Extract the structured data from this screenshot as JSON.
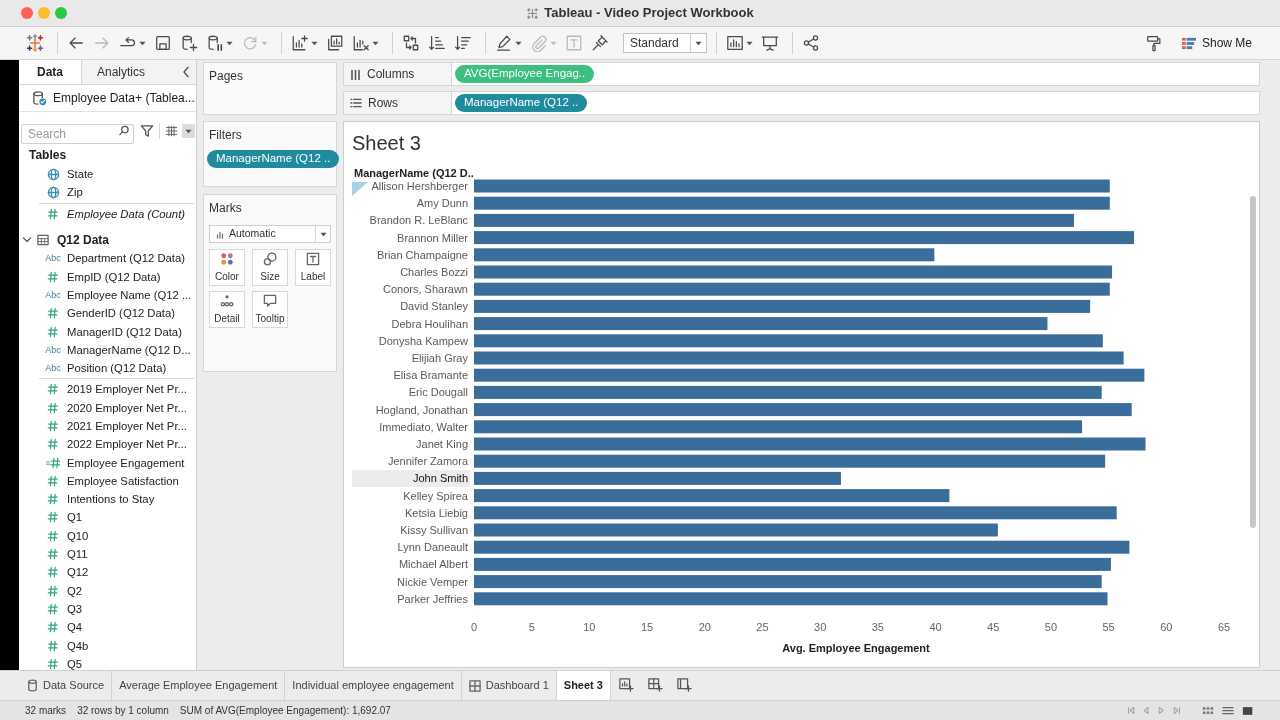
{
  "window": {
    "title": "Tableau - Video Project Workbook"
  },
  "toolbar": {
    "items": [
      {
        "kind": "logo",
        "disabled": false,
        "dropdown": false
      },
      {
        "kind": "separator"
      },
      {
        "kind": "undo",
        "disabled": false,
        "dropdown": false
      },
      {
        "kind": "redo",
        "disabled": true,
        "dropdown": false
      },
      {
        "kind": "replay",
        "disabled": false,
        "dropdown": true
      },
      {
        "kind": "save",
        "disabled": false,
        "dropdown": false
      },
      {
        "kind": "new_data_source",
        "disabled": false,
        "dropdown": false
      },
      {
        "kind": "pause_updates",
        "disabled": false,
        "dropdown": true
      },
      {
        "kind": "refresh",
        "disabled": true,
        "dropdown": true
      },
      {
        "kind": "separator"
      },
      {
        "kind": "new_worksheet",
        "disabled": false,
        "dropdown": true
      },
      {
        "kind": "duplicate",
        "disabled": false,
        "dropdown": false
      },
      {
        "kind": "clear",
        "disabled": false,
        "dropdown": true
      },
      {
        "kind": "separator"
      },
      {
        "kind": "swap",
        "disabled": false,
        "dropdown": false
      },
      {
        "kind": "sort_ascending",
        "disabled": false,
        "dropdown": false
      },
      {
        "kind": "sort_descending",
        "disabled": false,
        "dropdown": false
      },
      {
        "kind": "separator"
      },
      {
        "kind": "highlight",
        "disabled": false,
        "dropdown": true
      },
      {
        "kind": "group",
        "disabled": true,
        "dropdown": true
      },
      {
        "kind": "labels",
        "disabled": true,
        "dropdown": false
      },
      {
        "kind": "pin",
        "disabled": false,
        "dropdown": false
      },
      {
        "kind": "select",
        "value": "Standard"
      },
      {
        "kind": "separator"
      },
      {
        "kind": "show_cards",
        "disabled": false,
        "dropdown": true
      },
      {
        "kind": "presentation",
        "disabled": false,
        "dropdown": false
      },
      {
        "kind": "separator"
      },
      {
        "kind": "share",
        "disabled": false,
        "dropdown": false
      }
    ],
    "right_items": [
      {
        "kind": "format",
        "disabled": false,
        "dropdown": false
      },
      {
        "kind": "show_me",
        "label": "Show Me",
        "disabled": false,
        "dropdown": false
      }
    ]
  },
  "data_pane": {
    "tabs": [
      {
        "label": "Data",
        "selected": true
      },
      {
        "label": "Analytics",
        "selected": false
      }
    ],
    "data_source": "Employee Data+ (Tablea...",
    "search": {
      "placeholder": "Search"
    },
    "tables_heading": "Tables",
    "fields": [
      {
        "label": "State",
        "kind": "geo"
      },
      {
        "label": "Zip",
        "kind": "geo"
      },
      {
        "kind": "separator"
      },
      {
        "label": "Employee Data (Count)",
        "kind": "count"
      },
      {
        "label": "Q12 Data",
        "kind": "table",
        "expanded": true,
        "children": [
          {
            "label": "Department (Q12 Data)",
            "kind": "dimension",
            "type_label": "Abc"
          },
          {
            "label": "EmpID (Q12 Data)",
            "kind": "measure"
          },
          {
            "label": "Employee Name (Q12 ...",
            "kind": "dimension",
            "type_label": "Abc"
          },
          {
            "label": "GenderID (Q12 Data)",
            "kind": "measure"
          },
          {
            "label": "ManagerID (Q12 Data)",
            "kind": "measure"
          },
          {
            "label": "ManagerName (Q12 D...",
            "kind": "dimension",
            "type_label": "Abc"
          },
          {
            "label": "Position (Q12 Data)",
            "kind": "dimension",
            "type_label": "Abc"
          },
          {
            "kind": "separator"
          },
          {
            "label": "2019 Employer Net Pr...",
            "kind": "measure"
          },
          {
            "label": "2020 Employer Net Pr...",
            "kind": "measure"
          },
          {
            "label": "2021 Employer Net Pr...",
            "kind": "measure"
          },
          {
            "label": "2022 Employer Net Pr...",
            "kind": "measure"
          },
          {
            "label": "Employee Engagement",
            "kind": "calc"
          },
          {
            "label": "Employee Satisfaction",
            "kind": "measure"
          },
          {
            "label": "Intentions to Stay",
            "kind": "measure"
          },
          {
            "label": "Q1",
            "kind": "measure"
          },
          {
            "label": "Q10",
            "kind": "measure"
          },
          {
            "label": "Q11",
            "kind": "measure"
          },
          {
            "label": "Q12",
            "kind": "measure"
          },
          {
            "label": "Q2",
            "kind": "measure"
          },
          {
            "label": "Q3",
            "kind": "measure"
          },
          {
            "label": "Q4",
            "kind": "measure"
          },
          {
            "label": "Q4b",
            "kind": "measure"
          },
          {
            "label": "Q5",
            "kind": "measure"
          }
        ]
      }
    ]
  },
  "pages": {
    "title": "Pages"
  },
  "filters": {
    "title": "Filters",
    "pills": [
      {
        "label": "ManagerName (Q12 ..",
        "kind": "dimension"
      }
    ]
  },
  "marks": {
    "title": "Marks",
    "mark_type": "Automatic",
    "buttons": [
      {
        "label": "Color",
        "kind": "color"
      },
      {
        "label": "Size",
        "kind": "size"
      },
      {
        "label": "Label",
        "kind": "label"
      },
      {
        "label": "Detail",
        "kind": "detail"
      },
      {
        "label": "Tooltip",
        "kind": "tooltip"
      }
    ]
  },
  "shelves": [
    {
      "label": "Columns",
      "kind": "columns",
      "pills": [
        {
          "label": "AVG(Employee Engag..",
          "kind": "measure"
        }
      ]
    },
    {
      "label": "Rows",
      "kind": "rows",
      "pills": [
        {
          "label": "ManagerName (Q12 ..",
          "kind": "dimension"
        }
      ]
    }
  ],
  "view": {
    "title": "Sheet 3",
    "row_headers": [
      {
        "selected": false
      },
      {
        "selected": false
      },
      {
        "selected": false
      },
      {
        "selected": false
      },
      {
        "selected": false
      },
      {
        "selected": false
      },
      {
        "selected": false
      },
      {
        "selected": false
      },
      {
        "selected": false
      },
      {
        "selected": false
      },
      {
        "selected": false
      },
      {
        "selected": false
      },
      {
        "selected": false
      },
      {
        "selected": false
      },
      {
        "selected": false
      },
      {
        "selected": false
      },
      {
        "selected": false
      },
      {
        "selected": true
      },
      {
        "selected": false
      },
      {
        "selected": false
      },
      {
        "selected": false
      },
      {
        "selected": false
      },
      {
        "selected": false
      },
      {
        "selected": false
      },
      {
        "selected": false
      }
    ],
    "chart_data": {
      "type": "bar",
      "orientation": "horizontal",
      "xlabel": "Avg. Employee Engagement",
      "ylabel": "ManagerName (Q12 D..",
      "categories": [
        "Allison Hershberger",
        "Amy Dunn",
        "Brandon R. LeBlanc",
        "Brannon Miller",
        "Brian Champaigne",
        "Charles Bozzi",
        "Conors, Sharawn",
        "David Stanley",
        "Debra Houlihan",
        "Donysha Kampew",
        "Elijiah Gray",
        "Elisa Bramante",
        "Eric Dougall",
        "Hogland, Jonathan",
        "Immediato, Walter",
        "Janet King",
        "Jennifer Zamora",
        "John Smith",
        "Kelley Spirea",
        "Ketsia Liebig",
        "Kissy Sullivan",
        "Lynn Daneault",
        "Michael Albert",
        "Nickie Vemper",
        "Parker Jeffries"
      ],
      "values": [
        55.1,
        55.1,
        52.0,
        57.2,
        39.9,
        55.3,
        55.1,
        53.4,
        49.7,
        54.5,
        56.3,
        58.1,
        54.4,
        57.0,
        52.7,
        58.2,
        54.7,
        31.8,
        41.2,
        55.7,
        45.4,
        56.8,
        55.2,
        54.4,
        54.9
      ],
      "xlim": [
        0,
        65
      ],
      "xticks": [
        0,
        5,
        10,
        15,
        20,
        25,
        30,
        35,
        40,
        45,
        50,
        55,
        60,
        65
      ]
    }
  },
  "sheet_tabs": [
    {
      "label": "Data Source",
      "kind": "data_source",
      "selected": false
    },
    {
      "label": "Average Employee Engagement",
      "kind": "worksheet",
      "selected": false
    },
    {
      "label": "Individual employee engagement",
      "kind": "worksheet",
      "selected": false
    },
    {
      "label": "Dashboard 1",
      "kind": "dashboard",
      "selected": false
    },
    {
      "label": "Sheet 3",
      "kind": "worksheet",
      "selected": true
    }
  ],
  "new_tab_buttons": [
    {
      "kind": "new_worksheet"
    },
    {
      "kind": "new_dashboard"
    },
    {
      "kind": "new_story"
    }
  ],
  "status_bar": [
    "32 marks",
    "32 rows by 1 column",
    "SUM of AVG(Employee Engagement): 1,692.07"
  ]
}
